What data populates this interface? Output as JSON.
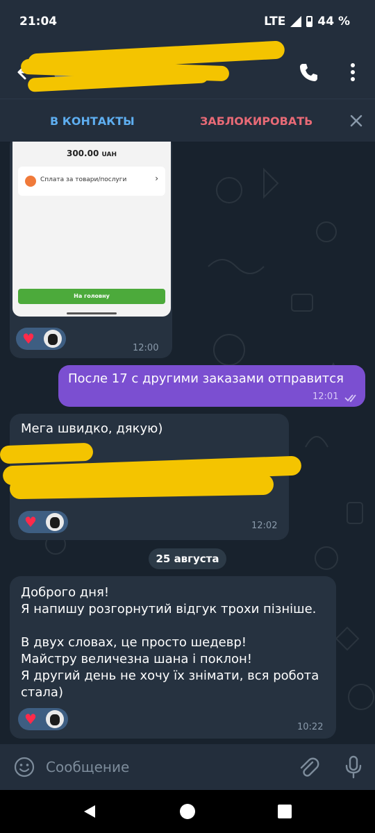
{
  "status_bar": {
    "time": "21:04",
    "network": "LTE",
    "battery": "44 %"
  },
  "header": {
    "back_icon": "arrow-left-icon",
    "call_icon": "phone-icon",
    "menu_icon": "more-vertical-icon"
  },
  "action_bar": {
    "add_contact": "В КОНТАКТЫ",
    "block": "ЗАБЛОКИРОВАТЬ",
    "close_icon": "close-icon"
  },
  "receipt": {
    "amount": "300.00",
    "currency": "UAH",
    "payment_label": "Сплата за товари/послуги",
    "home_button": "На головну"
  },
  "messages": [
    {
      "id": "m1",
      "direction": "in",
      "kind": "image",
      "time": "12:00",
      "reactions": [
        "heart",
        "avatar"
      ]
    },
    {
      "id": "m2",
      "direction": "out",
      "text": "После 17 с другими заказами отправится",
      "time": "12:01",
      "read": true
    },
    {
      "id": "m3",
      "direction": "in",
      "text": "Мега швидко, дякую)",
      "time": "12:02",
      "reactions": [
        "heart",
        "avatar"
      ]
    },
    {
      "id": "m4",
      "direction": "in",
      "text": "Доброго дня!\nЯ напишу розгорнутий відгук трохи пізніше.\n\nВ двух словах, це просто шедевр!\nМайстру величезна шана і поклон!\nЯ другий день не хочу їх знімати, вся робота\nстала)",
      "time": "10:22",
      "reactions": [
        "heart",
        "avatar"
      ]
    }
  ],
  "date_separator": "25 августа",
  "input": {
    "placeholder": "Сообщение",
    "emoji_icon": "emoji-icon",
    "attach_icon": "paperclip-icon",
    "mic_icon": "microphone-icon"
  },
  "colors": {
    "accent_blue": "#5eaef0",
    "block_red": "#e86a76",
    "outgoing_bubble": "#7b4fd1",
    "incoming_bubble": "#263240",
    "redaction": "#f4c400"
  }
}
